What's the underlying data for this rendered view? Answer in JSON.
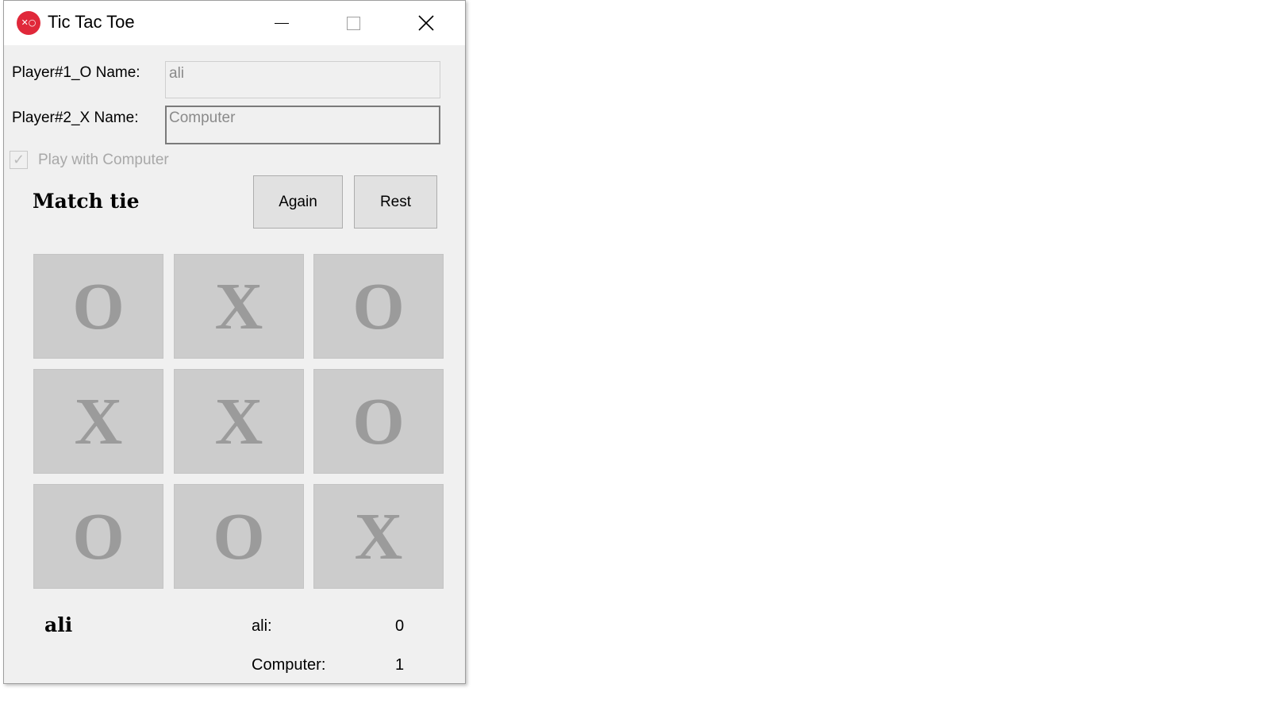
{
  "window": {
    "title": "Tic Tac Toe",
    "app_icon": "tic-tac-toe-icon"
  },
  "form": {
    "player1_label": "Player#1_O Name:",
    "player1_value": "ali",
    "player2_label": "Player#2_X Name:",
    "player2_value": "Computer",
    "play_with_computer_label": "Play with Computer",
    "play_with_computer_checked": true
  },
  "status": {
    "message": "Match tie"
  },
  "buttons": {
    "again_label": "Again",
    "reset_label": "Rest"
  },
  "board": {
    "cells": [
      "O",
      "X",
      "O",
      "X",
      "X",
      "O",
      "O",
      "O",
      "X"
    ]
  },
  "footer": {
    "current_player": "ali",
    "score1_label": "ali:",
    "score1_value": "0",
    "score2_label": "Computer:",
    "score2_value": "1"
  },
  "colors": {
    "icon_red": "#e0283a",
    "cell_bg": "#cccccc",
    "cell_mark": "#9b9b9b"
  }
}
